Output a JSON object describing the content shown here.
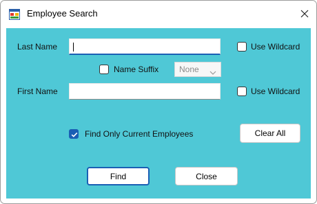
{
  "window": {
    "title": "Employee Search",
    "close_glyph": "✕",
    "client_color": "#4fc8d6"
  },
  "form": {
    "last_name": {
      "label": "Last Name",
      "value": "",
      "wildcard_label": "Use Wildcard",
      "wildcard_checked": false
    },
    "name_suffix": {
      "label": "Name Suffix",
      "checked": false,
      "selected": "None"
    },
    "first_name": {
      "label": "First Name",
      "value": "",
      "wildcard_label": "Use Wildcard",
      "wildcard_checked": false
    },
    "current_only": {
      "label": "Find Only Current Employees",
      "checked": true
    }
  },
  "buttons": {
    "clear_all": "Clear All",
    "find": "Find",
    "close": "Close"
  },
  "icons": {
    "app": "app-window-icon",
    "close": "close-icon",
    "dropdown": "chevron-down-icon",
    "check": "checkmark-icon"
  },
  "colors": {
    "accent": "#1a5fb4",
    "background": "#4fc8d6"
  }
}
